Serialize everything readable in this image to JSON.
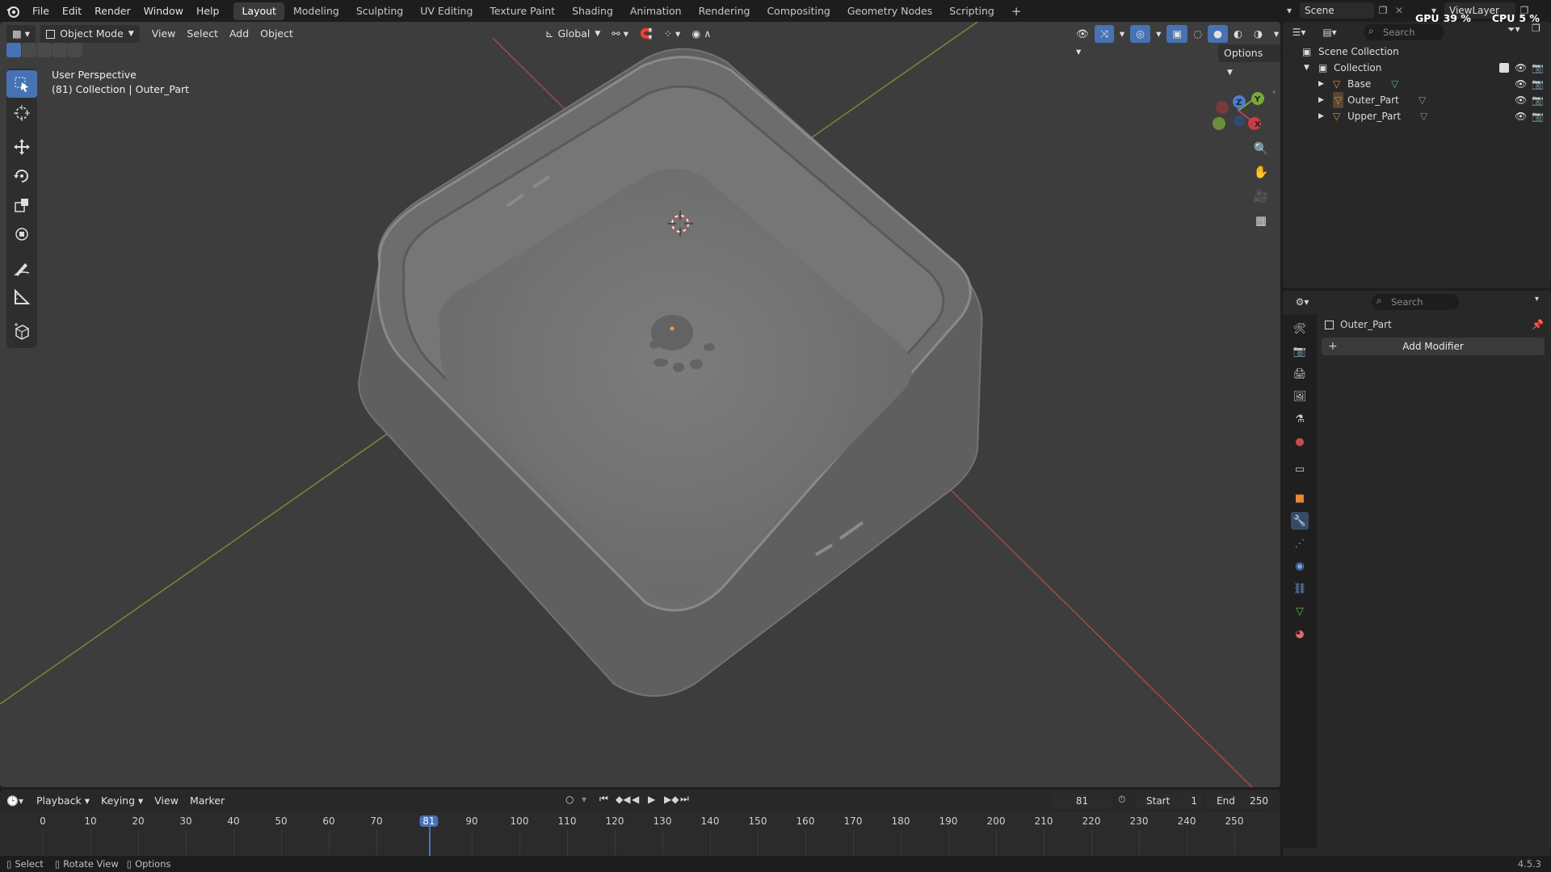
{
  "topbar": {
    "menus": [
      "File",
      "Edit",
      "Render",
      "Window",
      "Help"
    ],
    "workspaces": [
      "Layout",
      "Modeling",
      "Sculpting",
      "UV Editing",
      "Texture Paint",
      "Shading",
      "Animation",
      "Rendering",
      "Compositing",
      "Geometry Nodes",
      "Scripting"
    ],
    "active_workspace": "Layout",
    "add_workspace": "+",
    "scene": "Scene",
    "view_layer": "ViewLayer",
    "gpu_label": "GPU",
    "gpu_value": "39 %",
    "cpu_label": "CPU",
    "cpu_value": "5 %"
  },
  "viewport": {
    "mode": "Object Mode",
    "menus": [
      "View",
      "Select",
      "Add",
      "Object"
    ],
    "transform_orientation": "Global",
    "options_label": "Options",
    "info_line1": "User Perspective",
    "info_line2": "(81) Collection | Outer_Part",
    "gizmo_axes": [
      "X",
      "Y",
      "Z"
    ],
    "tools": [
      "select-box-icon",
      "cursor-icon",
      "move-icon",
      "rotate-icon",
      "scale-icon",
      "transform-icon",
      "annotate-icon",
      "measure-icon",
      "add-cube-icon"
    ]
  },
  "outliner": {
    "search_placeholder": "Search",
    "scene_collection": "Scene Collection",
    "collection": "Collection",
    "objects": [
      {
        "name": "Base"
      },
      {
        "name": "Outer_Part"
      },
      {
        "name": "Upper_Part"
      }
    ]
  },
  "properties": {
    "search_placeholder": "Search",
    "object_name": "Outer_Part",
    "add_modifier_label": "Add Modifier",
    "add_modifier_icon": "+",
    "tabs": [
      "tool-icon",
      "render-icon",
      "output-icon",
      "view-layer-icon",
      "scene-icon",
      "world-icon",
      "collection-icon",
      "object-icon",
      "modifier-icon",
      "particles-icon",
      "physics-icon",
      "constraints-icon",
      "data-icon",
      "material-icon"
    ]
  },
  "timeline": {
    "menus": [
      "Playback",
      "Keying",
      "View",
      "Marker"
    ],
    "current_frame": "81",
    "start_label": "Start",
    "start_value": "1",
    "end_label": "End",
    "end_value": "250",
    "ruler": [
      "0",
      "10",
      "20",
      "30",
      "40",
      "50",
      "60",
      "70",
      "81",
      "90",
      "100",
      "110",
      "120",
      "130",
      "140",
      "150",
      "160",
      "170",
      "180",
      "190",
      "200",
      "210",
      "220",
      "230",
      "240",
      "250"
    ]
  },
  "statusbar": {
    "select": "Select",
    "rotate_view": "Rotate View",
    "options": "Options",
    "version": "4.5.3"
  },
  "colors": {
    "accent": "#4772b3",
    "x_axis": "#c83c46",
    "y_axis": "#7aa83a",
    "z_axis": "#4a7ecb",
    "object_orange": "#e8893a",
    "mesh_green": "#5fb35f"
  }
}
